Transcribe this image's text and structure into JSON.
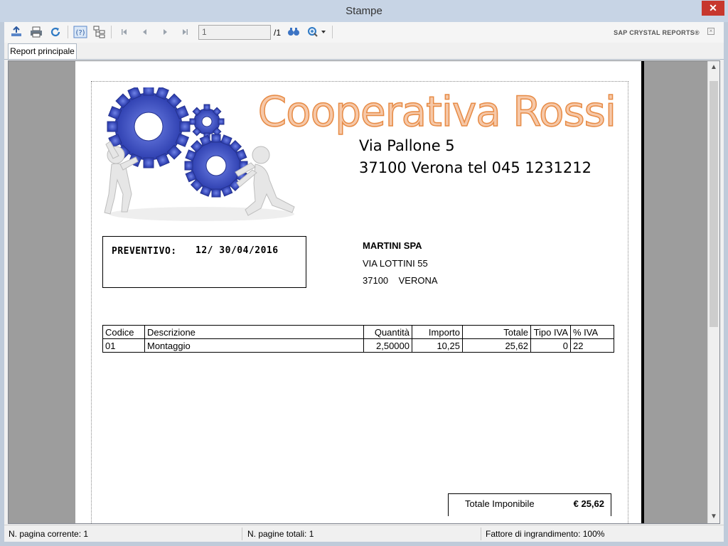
{
  "window": {
    "title": "Stampe",
    "close_glyph": "✕"
  },
  "toolbar": {
    "icons": [
      "export-icon",
      "print-icon",
      "refresh-icon",
      "help-icon",
      "group-tree-icon",
      "first-page-icon",
      "prev-page-icon",
      "next-page-icon",
      "last-page-icon",
      "find-icon",
      "zoom-icon"
    ],
    "page_value": "1",
    "page_of": "/1",
    "brand": "SAP CRYSTAL REPORTS®"
  },
  "tabs": [
    {
      "label": "Report principale"
    }
  ],
  "report": {
    "company_name": "Cooperativa Rossi",
    "address_line1": "Via Pallone 5",
    "address_line2": "37100 Verona tel 045 1231212",
    "quote_label": "PREVENTIVO:",
    "quote_value": "12/ 30/04/2016",
    "customer": {
      "name": "MARTINI SPA",
      "street": "VIA LOTTINI 55",
      "city": "37100    VERONA"
    },
    "table": {
      "headers": [
        "Codice",
        "Descrizione",
        "Quantità",
        "Importo",
        "Totale",
        "Tipo IVA",
        "% IVA"
      ],
      "rows": [
        [
          "01",
          "Montaggio",
          "2,50000",
          "10,25",
          "25,62",
          "0",
          "22"
        ]
      ]
    },
    "total_label": "Totale Imponibile",
    "total_value": "€ 25,62"
  },
  "status": {
    "current_page": "N. pagina corrente: 1",
    "total_pages": "N. pagine totali: 1",
    "zoom": "Fattore di ingrandimento: 100%"
  },
  "colors": {
    "titlebar": "#c7d4e5",
    "close_button": "#c7372d",
    "company_fill": "#f6c8a8",
    "company_stroke": "#e78b45",
    "gear_blue": "#3b4fc4"
  }
}
